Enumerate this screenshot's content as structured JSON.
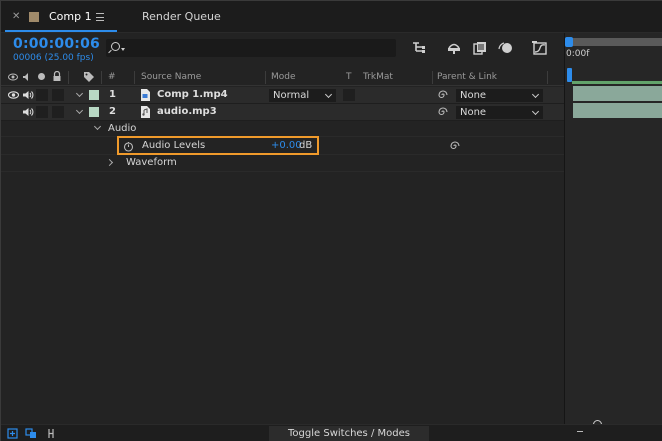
{
  "tabs": {
    "comp": "Comp 1",
    "render_queue": "Render Queue"
  },
  "timecode": "0:00:00:06",
  "frames_fps": "00006 (25.00 fps)",
  "columns": {
    "num": "#",
    "source_name": "Source Name",
    "mode": "Mode",
    "t": "T",
    "trkmat": "TrkMat",
    "parent_link": "Parent & Link"
  },
  "layers": [
    {
      "num": "1",
      "name": "Comp 1.mp4",
      "mode": "Normal",
      "parent": "None"
    },
    {
      "num": "2",
      "name": "audio.mp3",
      "parent": "None"
    }
  ],
  "audio_group": "Audio",
  "audio_levels": {
    "label": "Audio Levels",
    "value": "+0.00",
    "unit": "dB"
  },
  "waveform": "Waveform",
  "timeline_start": "0:00f",
  "bottom": {
    "toggle_label": "Toggle Switches / Modes"
  },
  "colors": {
    "accent": "#2d8ceb",
    "highlight": "#f09a2b",
    "layer_label": "#b8d8c4",
    "work_area": "#62a36b"
  }
}
